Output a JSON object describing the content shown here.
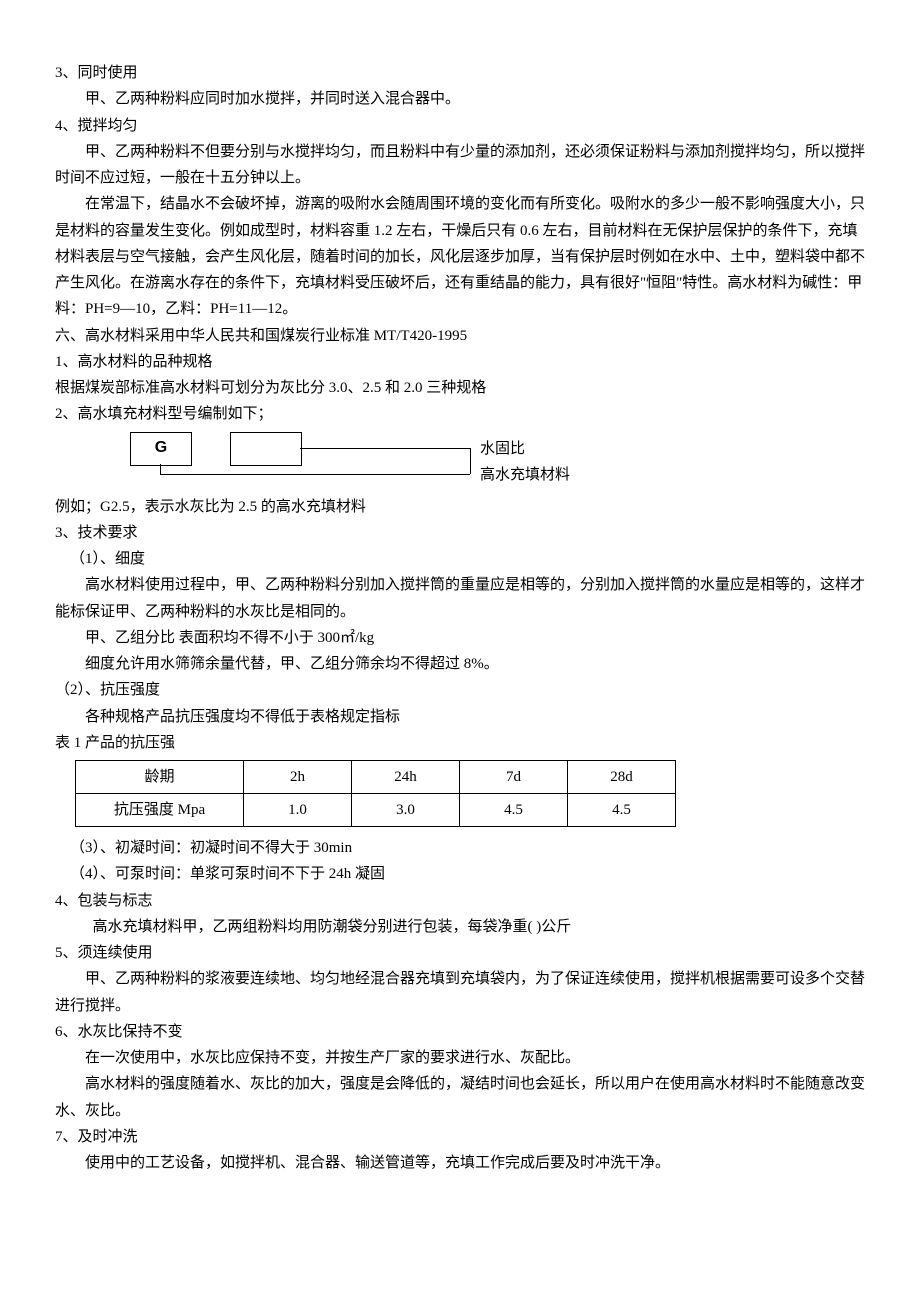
{
  "sec3": {
    "title": "3、同时使用",
    "body": "甲、乙两种粉料应同时加水搅拌，并同时送入混合器中。"
  },
  "sec4": {
    "title": "4、搅拌均匀",
    "p1": "甲、乙两种粉料不但要分别与水搅拌均匀，而且粉料中有少量的添加剂，还必须保证粉料与添加剂搅拌均匀，所以搅拌时间不应过短，一般在十五分钟以上。",
    "p2": "在常温下，结晶水不会破坏掉，游离的吸附水会随周围环境的变化而有所变化。吸附水的多少一般不影响强度大小，只是材料的容量发生变化。例如成型时，材料容重 1.2 左右，干燥后只有 0.6 左右，目前材料在无保护层保护的条件下，充填材料表层与空气接触，会产生风化层，随着时间的加长，风化层逐步加厚，当有保护层时例如在水中、土中，塑料袋中都不产生风化。在游离水存在的条件下，充填材料受压破坏后，还有重结晶的能力，具有很好\"恒阻\"特性。高水材料为碱性：甲料：PH=9—10，乙料：PH=11—12。"
  },
  "sec6": {
    "title": "六、高水材料采用中华人民共和国煤炭行业标准 MT/T420-1995",
    "s1": {
      "title": "1、高水材料的品种规格",
      "body": "根据煤炭部标准高水材料可划分为灰比分 3.0、2.5 和 2.0 三种规格"
    },
    "s2": {
      "title": "2、高水填充材料型号编制如下；",
      "g": "G",
      "lbl1": "水固比",
      "lbl2": "高水充填材料",
      "example": "例如；G2.5，表示水灰比为 2.5 的高水充填材料"
    },
    "s3": {
      "title": "3、技术要求",
      "fineness": {
        "title": "（1）、细度",
        "p1": "高水材料使用过程中，甲、乙两种粉料分别加入搅拌筒的重量应是相等的，分别加入搅拌筒的水量应是相等的，这样才能标保证甲、乙两种粉料的水灰比是相同的。",
        "p2": "甲、乙组分比 表面积均不得不小于 300㎡/kg",
        "p3": "细度允许用水筛筛余量代替，甲、乙组分筛余均不得超过 8%。"
      },
      "strength": {
        "title": "（2）、抗压强度",
        "p1": "各种规格产品抗压强度均不得低于表格规定指标",
        "caption": "表 1 产品的抗压强"
      },
      "setting": "（3）、初凝时间：初凝时间不得大于 30min",
      "pumping": "（4）、可泵时间：单浆可泵时间不下于 24h 凝固"
    },
    "s4": {
      "title": "4、包装与标志",
      "body": "高水充填材料甲，乙两组粉料均用防潮袋分别进行包装，每袋净重(    )公斤"
    },
    "s5": {
      "title": "5、须连续使用",
      "body": "甲、乙两种粉料的浆液要连续地、均匀地经混合器充填到充填袋内，为了保证连续使用，搅拌机根据需要可设多个交替进行搅拌。"
    },
    "s6": {
      "title": "6、水灰比保持不变",
      "p1": "在一次使用中，水灰比应保持不变，并按生产厂家的要求进行水、灰配比。",
      "p2": "高水材料的强度随着水、灰比的加大，强度是会降低的，凝结时间也会延长，所以用户在使用高水材料时不能随意改变水、灰比。"
    },
    "s7": {
      "title": "7、及时冲洗",
      "body": "使用中的工艺设备，如搅拌机、混合器、输送管道等，充填工作完成后要及时冲洗干净。"
    }
  },
  "table": {
    "r1": [
      "龄期",
      "2h",
      "24h",
      "7d",
      "28d"
    ],
    "r2": [
      "抗压强度 Mpa",
      "1.0",
      "3.0",
      "4.5",
      "4.5"
    ]
  },
  "chart_data": {
    "type": "table",
    "title": "表 1 产品的抗压强",
    "columns": [
      "龄期",
      "2h",
      "24h",
      "7d",
      "28d"
    ],
    "rows": [
      {
        "label": "抗压强度 Mpa",
        "values": [
          1.0,
          3.0,
          4.5,
          4.5
        ]
      }
    ]
  }
}
